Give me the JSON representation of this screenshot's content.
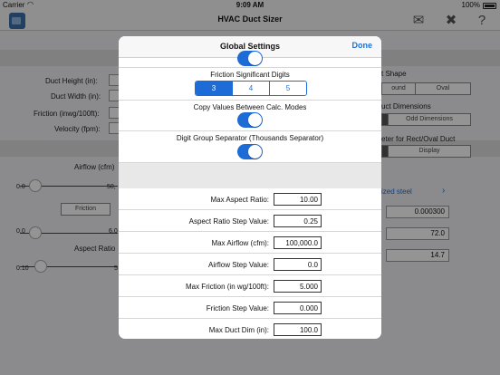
{
  "status": {
    "carrier": "Carrier",
    "time": "9:09 AM",
    "battery": "100%"
  },
  "nav": {
    "title": "HVAC Duct Sizer"
  },
  "background": {
    "duct_height": "Duct Height (in):",
    "duct_width": "Duct Width (in):",
    "friction": "Friction (inwg/100ft):",
    "velocity": "Velocity (fpm):",
    "airflow": "Airflow (cfm)",
    "slider1_min": "0.0",
    "slider1_max": "50,",
    "friction_tab": "Friction",
    "slider2_min": "0.0",
    "slider2_max": "6,0",
    "aspect_ratio": "Aspect Ratio",
    "slider3_min": "0.10",
    "slider3_max": "5",
    "shape_label": "t Shape",
    "shape_round": "ound",
    "shape_oval": "Oval",
    "dims_label": "uct Dimensions",
    "odd_dims": "Odd Dimensions",
    "diam_label": "eter for Rect/Oval Duct",
    "display": "Display",
    "material": "ized steel",
    "val1": "0.000300",
    "val2": "72.0",
    "val3": "14.7"
  },
  "modal": {
    "title": "Global Settings",
    "done": "Done",
    "friction_digits_label": "Friction Significant Digits",
    "digit_options": [
      "3",
      "4",
      "5"
    ],
    "copy_values_label": "Copy Values Between Calc. Modes",
    "group_sep_label": "Digit Group Separator (Thousands Separator)",
    "rows": [
      {
        "label": "Max Aspect Ratio:",
        "value": "10.00"
      },
      {
        "label": "Aspect Ratio Step Value:",
        "value": "0.25"
      },
      {
        "label": "Max Airflow (cfm):",
        "value": "100,000.0"
      },
      {
        "label": "Airflow Step Value:",
        "value": "0.0"
      },
      {
        "label": "Max Friction (in wg/100ft):",
        "value": "5.000"
      },
      {
        "label": "Friction Step Value:",
        "value": "0.000"
      },
      {
        "label": "Max Duct Dim (in):",
        "value": "100.0"
      }
    ]
  }
}
